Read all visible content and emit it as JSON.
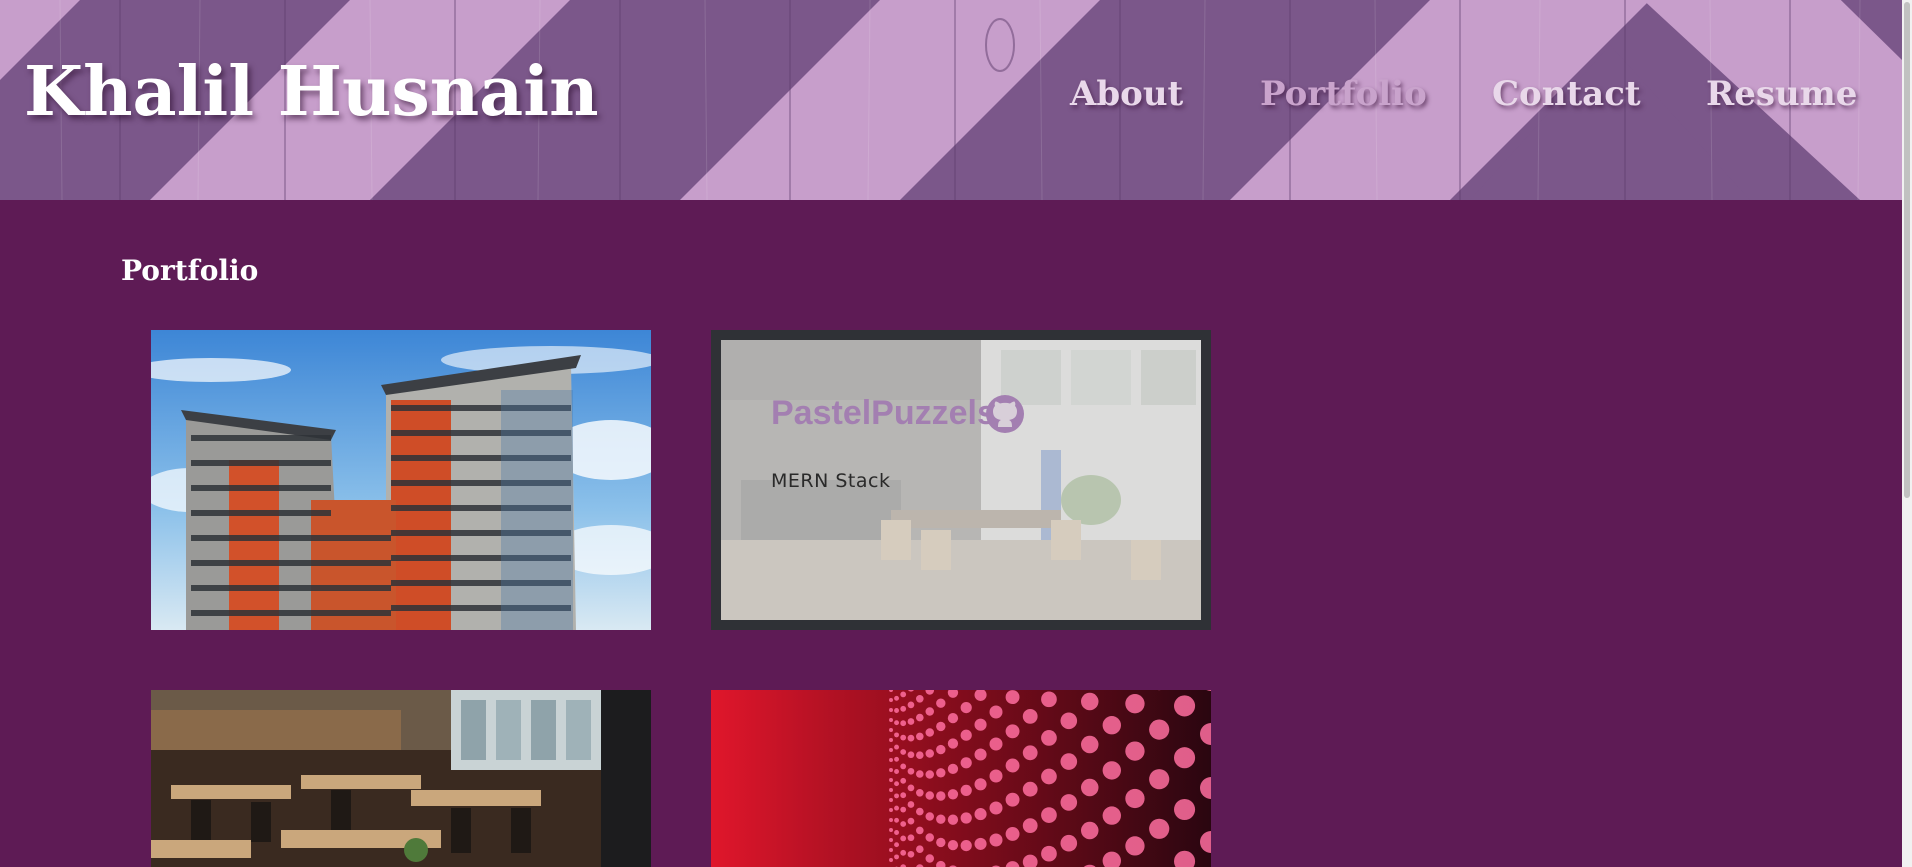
{
  "header": {
    "brand": "Khalil Husnain",
    "nav": [
      {
        "label": "About",
        "active": false
      },
      {
        "label": "Portfolio",
        "active": true
      },
      {
        "label": "Contact",
        "active": false
      },
      {
        "label": "Resume",
        "active": false
      }
    ]
  },
  "portfolio": {
    "title": "Portfolio",
    "projects": [
      {
        "image": "apartment-buildings",
        "title": "",
        "stack": ""
      },
      {
        "image": "cafe-interior",
        "title": "PastelPuzzels",
        "stack": "MERN Stack",
        "link_icon": "github-icon"
      },
      {
        "image": "restaurant-tables",
        "title": "",
        "stack": ""
      },
      {
        "image": "red-led-wall",
        "title": "",
        "stack": ""
      }
    ]
  },
  "colors": {
    "background": "#5e1b55",
    "header_wood": "#7a5589",
    "header_stripe": "#c9a0cc",
    "project_title": "#a37fb1"
  }
}
